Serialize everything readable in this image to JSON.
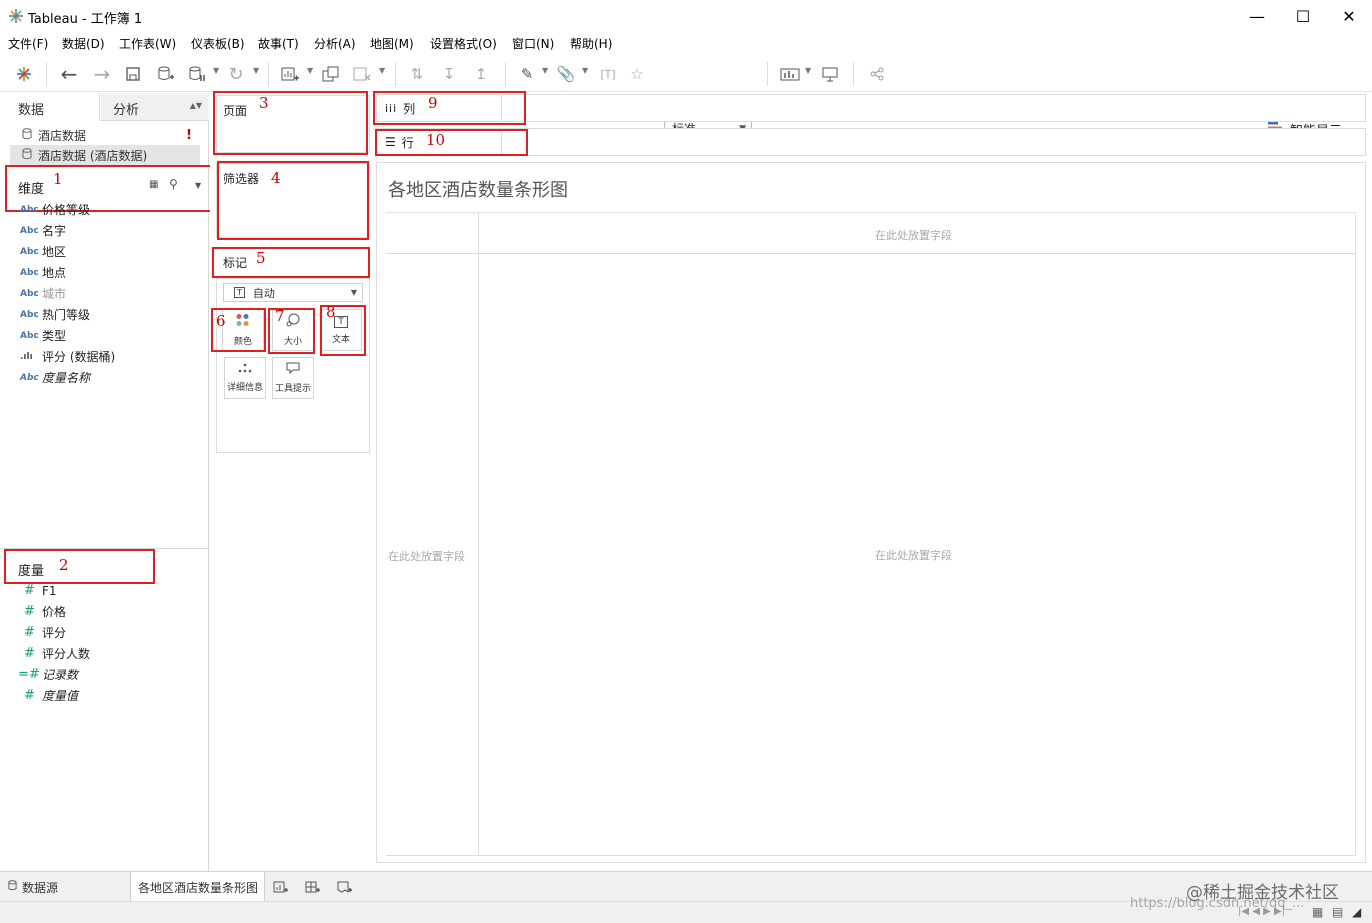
{
  "window": {
    "title": "Tableau - 工作簿 1"
  },
  "menu": [
    "文件(F)",
    "数据(D)",
    "工作表(W)",
    "仪表板(B)",
    "故事(T)",
    "分析(A)",
    "地图(M)",
    "设置格式(O)",
    "窗口(N)",
    "帮助(H)"
  ],
  "toolbar": {
    "fit_select": "标准",
    "smart_show": "智能显示"
  },
  "left": {
    "tabs": [
      "数据",
      "分析"
    ],
    "datasources": [
      {
        "name": "酒店数据",
        "alert": "!"
      },
      {
        "name": "酒店数据 (酒店数据)"
      }
    ],
    "dimensions_header": "维度",
    "dimensions": [
      {
        "type": "Abc",
        "name": "价格等级"
      },
      {
        "type": "Abc",
        "name": "名字"
      },
      {
        "type": "Abc",
        "name": "地区"
      },
      {
        "type": "Abc",
        "name": "地点"
      },
      {
        "type": "Abc",
        "name": "城市"
      },
      {
        "type": "Abc",
        "name": "热门等级"
      },
      {
        "type": "Abc",
        "name": "类型"
      },
      {
        "type": ".ılı",
        "name": "评分 (数据桶)"
      },
      {
        "type": "Abc",
        "name": "度量名称"
      }
    ],
    "measures_header": "度量",
    "measures": [
      {
        "type": "#",
        "name": "F1"
      },
      {
        "type": "#",
        "name": "价格"
      },
      {
        "type": "#",
        "name": "评分"
      },
      {
        "type": "#",
        "name": "评分人数"
      },
      {
        "type": "=#",
        "name": "记录数"
      },
      {
        "type": "#",
        "name": "度量值"
      }
    ]
  },
  "cards": {
    "pages": "页面",
    "filters": "筛选器",
    "marks": "标记",
    "marks_type": "自动",
    "color": "颜色",
    "size": "大小",
    "text": "文本",
    "detail": "详细信息",
    "tooltip": "工具提示"
  },
  "shelves": {
    "columns": "列",
    "rows": "行"
  },
  "annotations": [
    "1",
    "2",
    "3",
    "4",
    "5",
    "6",
    "7",
    "8",
    "9",
    "10"
  ],
  "viz": {
    "title": "各地区酒店数量条形图",
    "drop_top": "在此处放置字段",
    "drop_left": "在此处放置字段",
    "drop_center": "在此处放置字段"
  },
  "bottom": {
    "datasource_tab": "数据源",
    "sheet_tab": "各地区酒店数量条形图"
  },
  "watermark": {
    "line1": "@稀土掘金技术社区",
    "line2": "https://blog.csdn.net/qq_..."
  },
  "colors": {
    "accent_red": "#e02020",
    "dimension_blue": "#4a73a8",
    "measure_green": "#1a9c7b"
  }
}
